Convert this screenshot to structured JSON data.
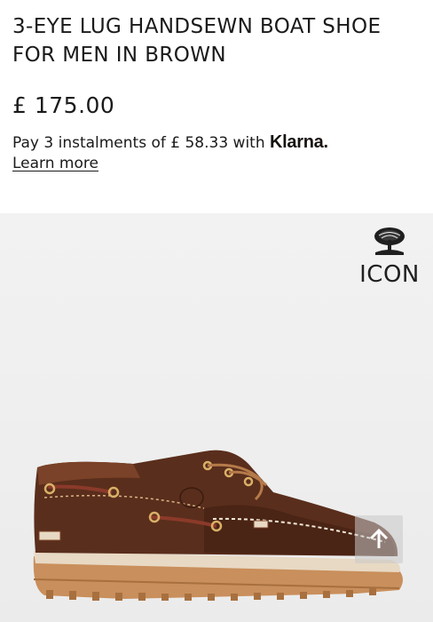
{
  "product": {
    "title": "3-EYE LUG HANDSEWN BOAT SHOE FOR MEN IN BROWN",
    "price": "£ 175.00"
  },
  "klarna": {
    "text_prefix": "Pay 3 instalments of £ 58.33 with",
    "brand": "Klarna.",
    "learn_more": "Learn more"
  },
  "image": {
    "badge_icon": "timberland-tree-icon",
    "badge_text": "ICON",
    "product_icon": "boat-shoe-image"
  },
  "controls": {
    "scroll_top_icon": "arrow-up-icon",
    "expand_icon": "expand-icon"
  },
  "colors": {
    "text": "#1a1a1a",
    "image_bg": "#efefef",
    "leather": "#5a2e1c",
    "sole": "#c98f5c"
  }
}
